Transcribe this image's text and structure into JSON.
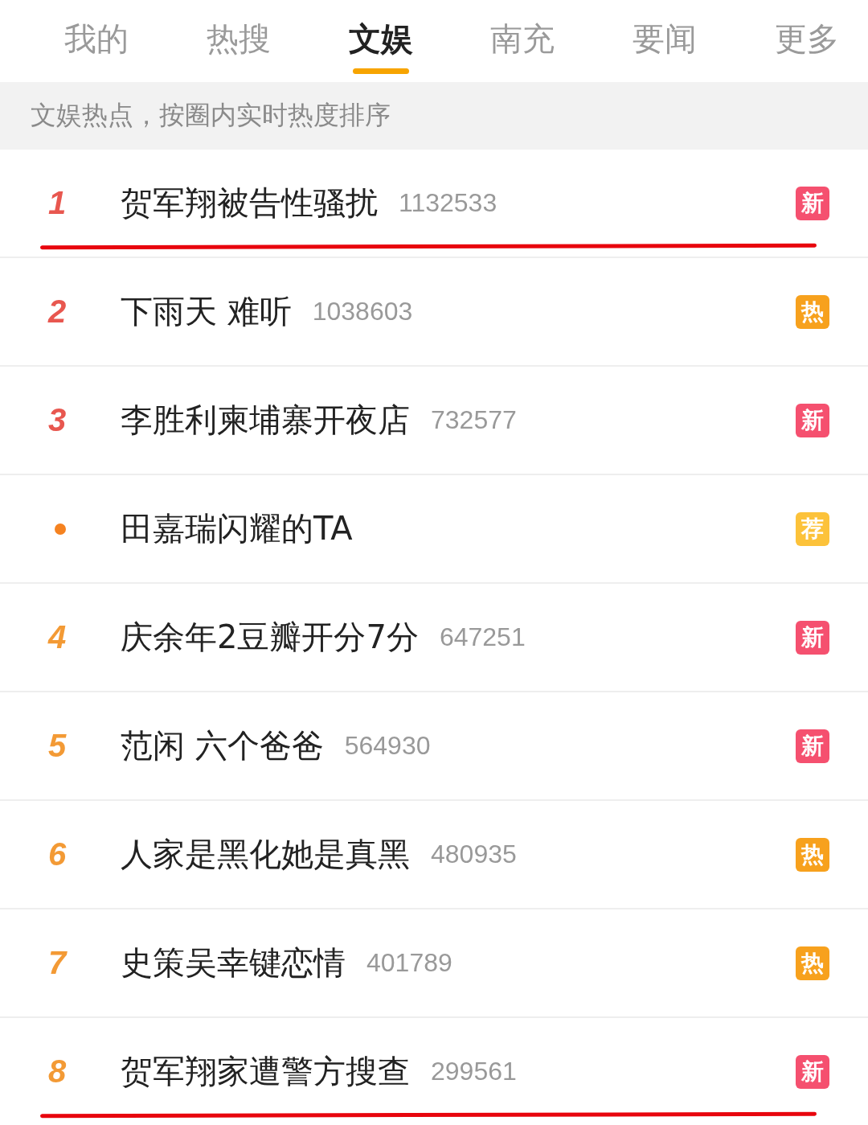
{
  "tabs": [
    {
      "label": "我的",
      "selected": false
    },
    {
      "label": "热搜",
      "selected": false
    },
    {
      "label": "文娱",
      "selected": true
    },
    {
      "label": "南充",
      "selected": false
    },
    {
      "label": "要闻",
      "selected": false
    },
    {
      "label": "更多",
      "selected": false
    }
  ],
  "subheader": "文娱热点，按圈内实时热度排序",
  "rows": [
    {
      "kind": "ranked",
      "rank": "1",
      "title": "贺军翔被告性骚扰",
      "count": "1132533",
      "badge": {
        "label": "新",
        "color": "#f5506f"
      },
      "underlined": true
    },
    {
      "kind": "ranked",
      "rank": "2",
      "title": "下雨天 难听",
      "count": "1038603",
      "badge": {
        "label": "热",
        "color": "#f7a11d"
      },
      "underlined": false
    },
    {
      "kind": "ranked",
      "rank": "3",
      "title": "李胜利柬埔寨开夜店",
      "count": "732577",
      "badge": {
        "label": "新",
        "color": "#f5506f"
      },
      "underlined": false
    },
    {
      "kind": "promoted",
      "title": "田嘉瑞闪耀的TA",
      "badge": {
        "label": "荐",
        "color": "#fcc23a"
      },
      "underlined": false
    },
    {
      "kind": "ranked",
      "rank": "4",
      "title": "庆余年2豆瓣开分7分",
      "count": "647251",
      "badge": {
        "label": "新",
        "color": "#f5506f"
      },
      "underlined": false
    },
    {
      "kind": "ranked",
      "rank": "5",
      "title": "范闲 六个爸爸",
      "count": "564930",
      "badge": {
        "label": "新",
        "color": "#f5506f"
      },
      "underlined": false
    },
    {
      "kind": "ranked",
      "rank": "6",
      "title": "人家是黑化她是真黑",
      "count": "480935",
      "badge": {
        "label": "热",
        "color": "#f7a11d"
      },
      "underlined": false
    },
    {
      "kind": "ranked",
      "rank": "7",
      "title": "史策吴幸键恋情",
      "count": "401789",
      "badge": {
        "label": "热",
        "color": "#f7a11d"
      },
      "underlined": false
    },
    {
      "kind": "ranked",
      "rank": "8",
      "title": "贺军翔家遭警方搜查",
      "count": "299561",
      "badge": {
        "label": "新",
        "color": "#f5506f"
      },
      "underlined": true
    }
  ]
}
